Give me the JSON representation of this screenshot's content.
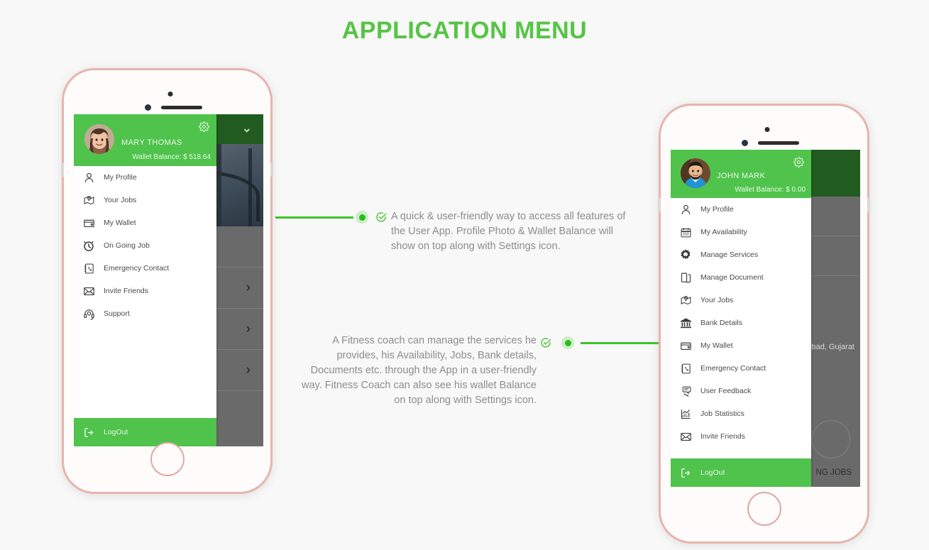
{
  "page": {
    "title": "APPLICATION MENU",
    "background_color": "#f7f8f7",
    "accent_green": "#4fc34b",
    "line_green": "#3fc229",
    "title_color": "#56c445",
    "phone_frame_color": "#e8b4ae"
  },
  "phone_user": {
    "device": "rose-gold-smartphone",
    "drawer": {
      "user_name": "MARY THOMAS",
      "wallet_balance": "Wallet Balance: $ 518.64",
      "settings_icon": "gear-icon",
      "avatar": "avatar-mary-thomas",
      "items": [
        {
          "label": "My Profile",
          "icon": "person-icon"
        },
        {
          "label": "Your Jobs",
          "icon": "map-pin-icon"
        },
        {
          "label": "My Wallet",
          "icon": "wallet-icon"
        },
        {
          "label": "On Going Job",
          "icon": "stopwatch-icon"
        },
        {
          "label": "Emergency Contact",
          "icon": "contact-book-icon"
        },
        {
          "label": "Invite Friends",
          "icon": "envelope-icon"
        },
        {
          "label": "Support",
          "icon": "headset-icon"
        }
      ],
      "logout": {
        "label": "LogOut",
        "icon": "logout-icon"
      }
    },
    "background_app": {
      "header_color": "#215b20",
      "chevron": "⌄",
      "rows": [
        {
          "chevron": "›"
        },
        {
          "chevron": "›"
        },
        {
          "chevron": "›"
        }
      ]
    }
  },
  "phone_coach": {
    "device": "rose-gold-smartphone",
    "drawer": {
      "user_name": "JOHN MARK",
      "wallet_balance": "Wallet Balance: $ 0.00",
      "settings_icon": "gear-icon",
      "avatar": "avatar-john-mark",
      "items": [
        {
          "label": "My Profile",
          "icon": "person-icon"
        },
        {
          "label": "My Availability",
          "icon": "calendar-icon"
        },
        {
          "label": "Manage Services",
          "icon": "gear-solid-icon"
        },
        {
          "label": "Manage Document",
          "icon": "documents-icon"
        },
        {
          "label": "Your Jobs",
          "icon": "map-pin-icon"
        },
        {
          "label": "Bank Details",
          "icon": "bank-icon"
        },
        {
          "label": "My Wallet",
          "icon": "wallet-icon"
        },
        {
          "label": "Emergency Contact",
          "icon": "contact-book-icon"
        },
        {
          "label": "User Feedback",
          "icon": "chat-bubbles-icon"
        },
        {
          "label": "Job Statistics",
          "icon": "bar-chart-icon"
        },
        {
          "label": "Invite Friends",
          "icon": "envelope-icon"
        }
      ],
      "logout": {
        "label": "LogOut",
        "icon": "logout-icon"
      }
    },
    "background_app": {
      "header_color": "#215b20",
      "location_text": "bad, Gujarat",
      "section_text": "NG JOBS"
    }
  },
  "annotations": [
    {
      "id": "annotation-user-app",
      "check_icon": "check-circle-icon",
      "dot_icon": "bullet-dot-icon",
      "text": "A quick & user-friendly way to access all features of the User App. Profile Photo & Wallet Balance will show on top along with Settings icon."
    },
    {
      "id": "annotation-coach-app",
      "check_icon": "check-circle-icon",
      "dot_icon": "bullet-dot-icon",
      "text": "A Fitness coach can manage the services he provides, his Availability, Jobs, Bank details, Documents etc. through the App in a user-friendly way. Fitness Coach can also see his wallet Balance on top along with Settings icon."
    }
  ]
}
